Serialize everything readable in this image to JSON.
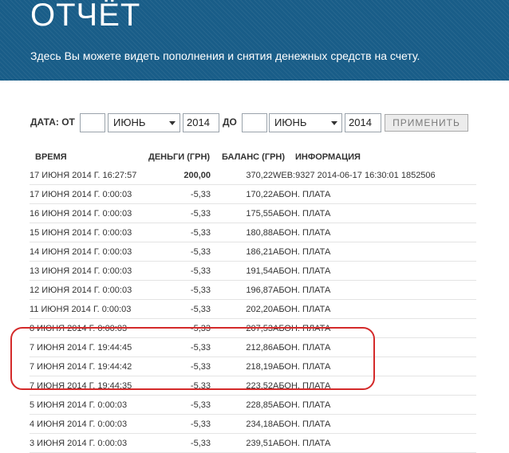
{
  "header": {
    "title": "ОТЧЁТ",
    "subtitle": "Здесь Вы можете видеть пополнения и снятия денежных средств на счету."
  },
  "filter": {
    "from_label": "ДАТА: ОТ",
    "from_day": "",
    "from_month": "ИЮНЬ",
    "from_year": "2014",
    "to_label": "ДО",
    "to_day": "",
    "to_month": "ИЮНЬ",
    "to_year": "2014",
    "apply_label": "ПРИМЕНИТЬ"
  },
  "table": {
    "columns": [
      "ВРЕМЯ",
      "ДЕНЬГИ (ГРН)",
      "БАЛАНС (ГРН)",
      "ИНФОРМАЦИЯ"
    ],
    "rows": [
      {
        "time": "17 ИЮНЯ 2014 Г. 16:27:57",
        "money": "200,00",
        "balance": "370,22",
        "info": "WEB:9327 2014-06-17 16:30:01 1852506"
      },
      {
        "time": "17 ИЮНЯ 2014 Г. 0:00:03",
        "money": "-5,33",
        "balance": "170,22",
        "info": "АБОН. ПЛАТА"
      },
      {
        "time": "16 ИЮНЯ 2014 Г. 0:00:03",
        "money": "-5,33",
        "balance": "175,55",
        "info": "АБОН. ПЛАТА"
      },
      {
        "time": "15 ИЮНЯ 2014 Г. 0:00:03",
        "money": "-5,33",
        "balance": "180,88",
        "info": "АБОН. ПЛАТА"
      },
      {
        "time": "14 ИЮНЯ 2014 Г. 0:00:03",
        "money": "-5,33",
        "balance": "186,21",
        "info": "АБОН. ПЛАТА"
      },
      {
        "time": "13 ИЮНЯ 2014 Г. 0:00:03",
        "money": "-5,33",
        "balance": "191,54",
        "info": "АБОН. ПЛАТА"
      },
      {
        "time": "12 ИЮНЯ 2014 Г. 0:00:03",
        "money": "-5,33",
        "balance": "196,87",
        "info": "АБОН. ПЛАТА"
      },
      {
        "time": "11 ИЮНЯ 2014 Г. 0:00:03",
        "money": "-5,33",
        "balance": "202,20",
        "info": "АБОН. ПЛАТА"
      },
      {
        "time": "8 ИЮНЯ 2014 Г. 0:00:03",
        "money": "-5,33",
        "balance": "207,53",
        "info": "АБОН. ПЛАТА"
      },
      {
        "time": "7 ИЮНЯ 2014 Г. 19:44:45",
        "money": "-5,33",
        "balance": "212,86",
        "info": "АБОН. ПЛАТА"
      },
      {
        "time": "7 ИЮНЯ 2014 Г. 19:44:42",
        "money": "-5,33",
        "balance": "218,19",
        "info": "АБОН. ПЛАТА"
      },
      {
        "time": "7 ИЮНЯ 2014 Г. 19:44:35",
        "money": "-5,33",
        "balance": "223,52",
        "info": "АБОН. ПЛАТА"
      },
      {
        "time": "5 ИЮНЯ 2014 Г. 0:00:03",
        "money": "-5,33",
        "balance": "228,85",
        "info": "АБОН. ПЛАТА"
      },
      {
        "time": "4 ИЮНЯ 2014 Г. 0:00:03",
        "money": "-5,33",
        "balance": "234,18",
        "info": "АБОН. ПЛАТА"
      },
      {
        "time": "3 ИЮНЯ 2014 Г. 0:00:03",
        "money": "-5,33",
        "balance": "239,51",
        "info": "АБОН. ПЛАТА"
      }
    ]
  },
  "colors": {
    "header_bg": "#195d88",
    "highlight": "#d42a2a"
  }
}
